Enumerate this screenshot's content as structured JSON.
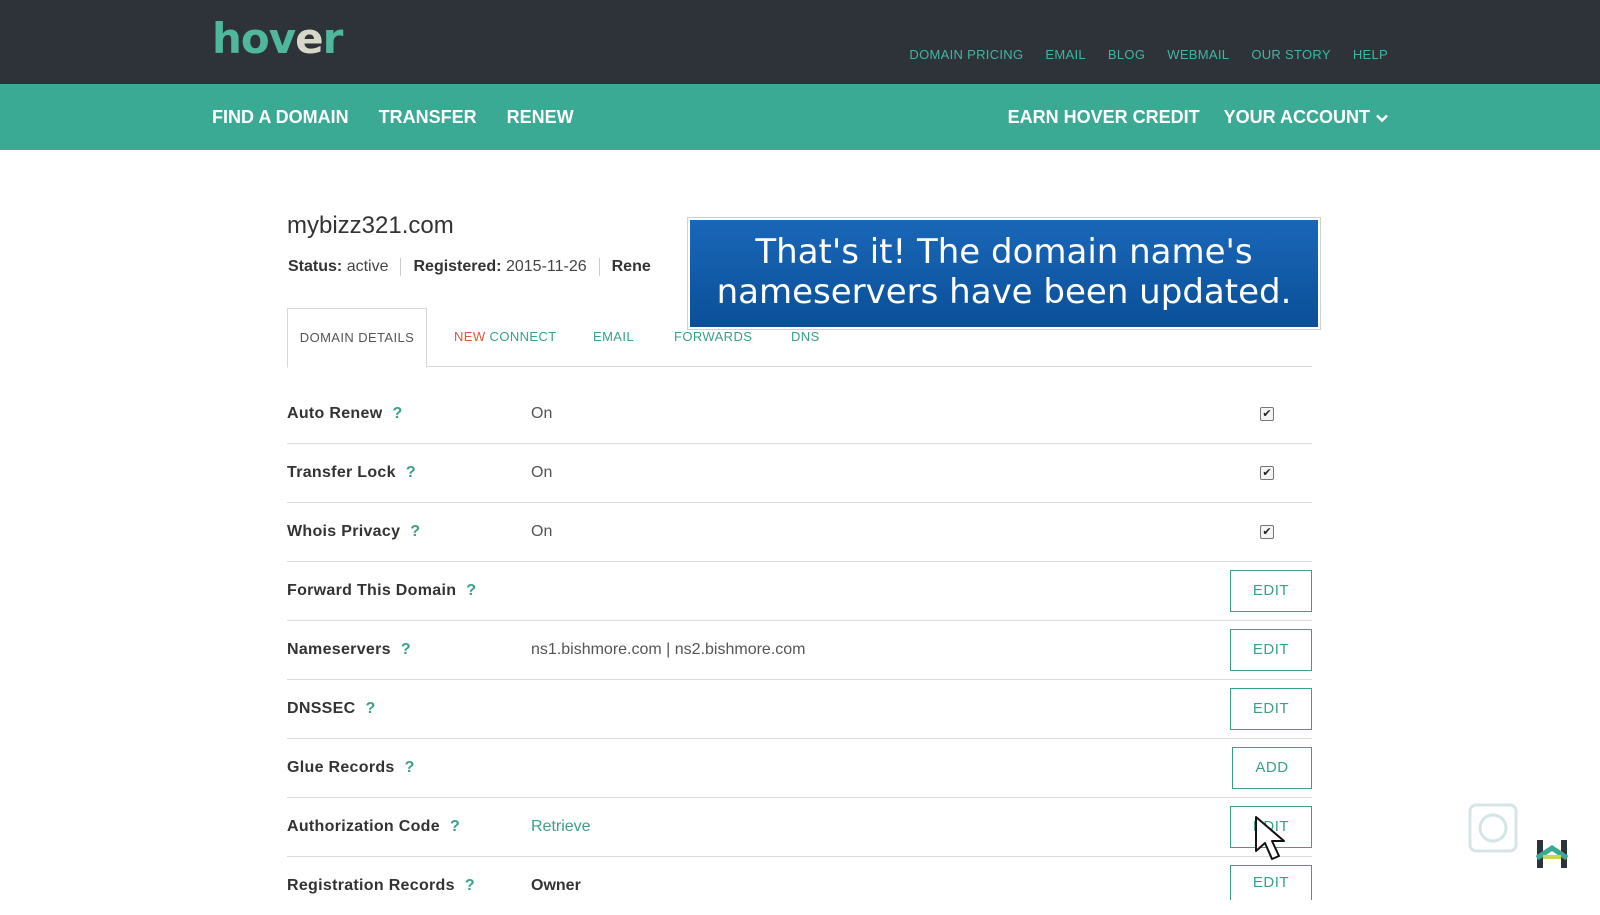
{
  "brand": {
    "logo_text_1": "hov",
    "logo_text_2": "e",
    "logo_text_3": "r"
  },
  "top_links": [
    "DOMAIN PRICING",
    "EMAIL",
    "BLOG",
    "WEBMAIL",
    "OUR STORY",
    "HELP"
  ],
  "nav": {
    "left": [
      "FIND A DOMAIN",
      "TRANSFER",
      "RENEW"
    ],
    "earn_credit": "EARN HOVER CREDIT",
    "account": "YOUR ACCOUNT"
  },
  "domain": {
    "name": "mybizz321.com",
    "status_label": "Status:",
    "status_value": "active",
    "registered_label": "Registered:",
    "registered_value": "2015-11-26",
    "renew_label_partial": "Rene"
  },
  "banner": {
    "line1": "That's it! The domain name's",
    "line2": "nameservers have been updated."
  },
  "tabs": {
    "domain_details": "DOMAIN DETAILS",
    "new_prefix": "NEW",
    "connect": "CONNECT",
    "email": "EMAIL",
    "forwards": "FORWARDS",
    "dns": "DNS"
  },
  "rows": [
    {
      "label": "Auto Renew",
      "value": "On",
      "control": "checkbox",
      "checked": true
    },
    {
      "label": "Transfer Lock",
      "value": "On",
      "control": "checkbox",
      "checked": true
    },
    {
      "label": "Whois Privacy",
      "value": "On",
      "control": "checkbox",
      "checked": true
    },
    {
      "label": "Forward This Domain",
      "value": "",
      "control": "button",
      "button_label": "EDIT"
    },
    {
      "label": "Nameservers",
      "value": "ns1.bishmore.com | ns2.bishmore.com",
      "control": "button",
      "button_label": "EDIT"
    },
    {
      "label": "DNSSEC",
      "value": "",
      "control": "button",
      "button_label": "EDIT"
    },
    {
      "label": "Glue Records",
      "value": "",
      "control": "button",
      "button_label": "ADD"
    },
    {
      "label": "Authorization Code",
      "value": "Retrieve",
      "control": "button",
      "button_label": "EDIT"
    },
    {
      "label": "Registration Records",
      "value": "Owner",
      "control": "button",
      "button_label": "EDIT"
    }
  ],
  "help_mark": "?",
  "checkmark": "✔",
  "colors": {
    "topbar": "#2e3339",
    "brand_green": "#3aaa95",
    "link_green": "#3aa08a",
    "banner_blue": "#0a4f98"
  }
}
